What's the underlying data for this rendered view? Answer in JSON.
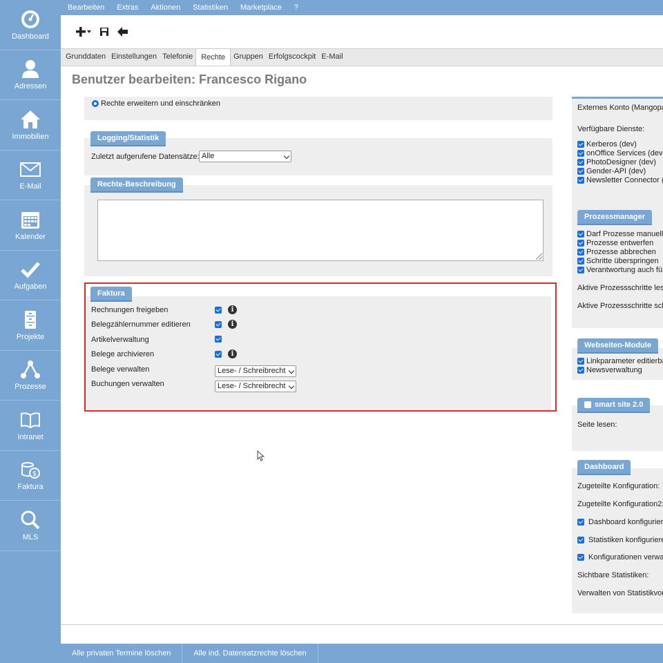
{
  "sidebar": {
    "items": [
      {
        "label": "Dashboard",
        "icon": "dashboard-icon"
      },
      {
        "label": "Adressen",
        "icon": "person-icon"
      },
      {
        "label": "Immobilien",
        "icon": "house-icon"
      },
      {
        "label": "E-Mail",
        "icon": "envelope-icon"
      },
      {
        "label": "Kalender",
        "icon": "calendar-icon"
      },
      {
        "label": "Aufgaben",
        "icon": "checkmark-icon"
      },
      {
        "label": "Projekte",
        "icon": "cabinet-icon"
      },
      {
        "label": "Prozesse",
        "icon": "process-icon"
      },
      {
        "label": "Intranet",
        "icon": "book-icon"
      },
      {
        "label": "Faktura",
        "icon": "coins-icon"
      },
      {
        "label": "MLS",
        "icon": "magnifier-icon"
      }
    ]
  },
  "menu": {
    "items": [
      "Bearbeiten",
      "Extras",
      "Aktionen",
      "Statistiken",
      "Marketplace",
      "?"
    ]
  },
  "tabs": [
    "Grunddaten",
    "Einstellungen",
    "Telefonie",
    "Rechte",
    "Gruppen",
    "Erfolgscockpit",
    "E-Mail"
  ],
  "page_title": "Benutzer bearbeiten: Francesco Rigano",
  "left": {
    "radio_label": "Rechte erweitern und einschränken",
    "logging": {
      "legend": "Logging/Statistik",
      "label": "Zuletzt aufgerufene Datensätze:",
      "value": "Alle"
    },
    "beschreibung": {
      "legend": "Rechte-Beschreibung"
    },
    "faktura": {
      "legend": "Faktura",
      "rows": [
        {
          "label": "Rechnungen freigeben"
        },
        {
          "label": "Belegzählernummer editieren"
        },
        {
          "label": "Artikelverwaltung"
        },
        {
          "label": "Belege archivieren"
        },
        {
          "label": "Belege verwalten",
          "value": "Lese- / Schreibrecht"
        },
        {
          "label": "Buchungen verwalten",
          "value": "Lese- / Schreibrecht"
        }
      ]
    }
  },
  "right": {
    "externes_konto": "Externes Konto (Mangopa",
    "dienste_label": "Verfügbare Dienste:",
    "dienste": [
      "Kerberos (dev)",
      "onOffice Services (dev",
      "PhotoDesigner (dev)",
      "Gender-API (dev)",
      "Newsletter Connector ("
    ],
    "prozessmanager": {
      "legend": "Prozessmanager",
      "items": [
        "Darf Prozesse manuell",
        "Prozesse entwerfen",
        "Prozesse abbrechen",
        "Schritte überspringen",
        "Verantwortung auch für"
      ],
      "aktive1": "Aktive Prozessschritte lese",
      "aktive2": "Aktive Prozessschritte sch"
    },
    "webseiten": {
      "legend": "Webseiten-Module",
      "items": [
        "Linkparameter editierba",
        "Newsverwaltung"
      ]
    },
    "smartsite": {
      "legend": "smart site 2.0",
      "seite": "Seite lesen:"
    },
    "dashboard": {
      "legend": "Dashboard",
      "konf1": "Zugeteilte Konfiguration:",
      "konf2": "Zugeteilte Konfiguration2:",
      "items": [
        "Dashboard konfiguriere",
        "Statistiken konfiguriere",
        "Konfigurationen verwal"
      ],
      "sichtbar": "Sichtbare Statistiken:",
      "verwalten": "Verwalten von Statistikvor"
    }
  },
  "bottom": {
    "btn1": "Alle privaten Termine löschen",
    "btn2": "Alle ind. Datensatzrechte löschen"
  },
  "colors": {
    "accent": "#7aa6d3",
    "highlight": "#d42b2b",
    "checkbox": "#1a6ed8"
  }
}
